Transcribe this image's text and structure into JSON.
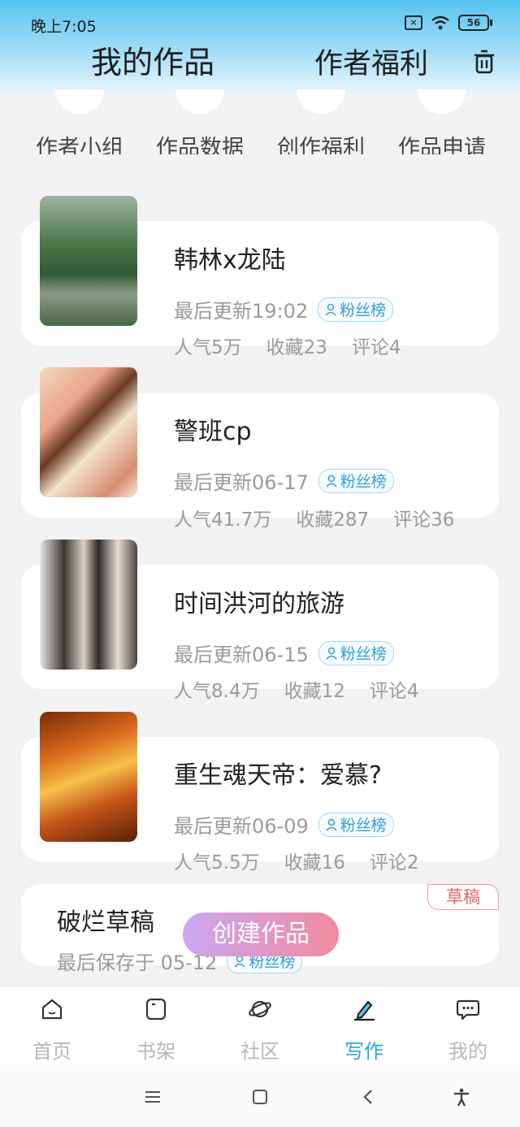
{
  "status": {
    "time": "晚上7:05",
    "battery": "56"
  },
  "header": {
    "tab_works": "我的作品",
    "tab_welfare": "作者福利"
  },
  "quick_links": [
    "作者小组",
    "作品数据",
    "创作福利",
    "作品申请"
  ],
  "works": [
    {
      "title": "韩林x龙陆",
      "updated": "最后更新19:02",
      "badge": "粉丝榜",
      "popularity": "人气5万",
      "favorites": "收藏23",
      "comments": "评论4"
    },
    {
      "title": "警班cp",
      "updated": "最后更新06-17",
      "badge": "粉丝榜",
      "popularity": "人气41.7万",
      "favorites": "收藏287",
      "comments": "评论36"
    },
    {
      "title": "时间洪河的旅游",
      "updated": "最后更新06-15",
      "badge": "粉丝榜",
      "popularity": "人气8.4万",
      "favorites": "收藏12",
      "comments": "评论4"
    },
    {
      "title": "重生魂天帝：爱慕?",
      "updated": "最后更新06-09",
      "badge": "粉丝榜",
      "popularity": "人气5.5万",
      "favorites": "收藏16",
      "comments": "评论2"
    }
  ],
  "draft": {
    "title": "破烂草稿",
    "saved": "最后保存于 05-12",
    "badge": "粉丝榜",
    "tag": "草稿"
  },
  "create_button": "创建作品",
  "bottom_nav": [
    {
      "label": "首页",
      "icon": "home-icon"
    },
    {
      "label": "书架",
      "icon": "bookshelf-icon"
    },
    {
      "label": "社区",
      "icon": "planet-icon"
    },
    {
      "label": "写作",
      "icon": "pen-icon",
      "active": true
    },
    {
      "label": "我的",
      "icon": "chat-bubble-icon"
    }
  ],
  "colors": {
    "accent": "#2aa6e0",
    "draft_tag": "#e06666"
  }
}
